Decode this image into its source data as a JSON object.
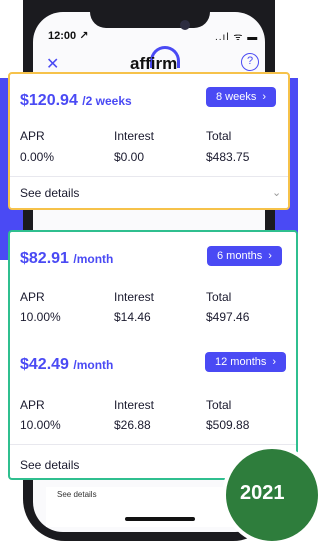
{
  "status_bar": {
    "time": "12:00 ↗",
    "icons": "..ıl ᯤ ▬"
  },
  "app": {
    "close_icon": "close-icon",
    "logo": "affirm",
    "help_icon": "help-icon",
    "help_glyph": "?"
  },
  "plans": [
    {
      "amount": "$120.94",
      "period": "/2 weeks",
      "term": "8 weeks",
      "apr": "0.00%",
      "interest": "$0.00",
      "total": "$483.75"
    },
    {
      "amount": "$82.91",
      "period": "/month",
      "term": "6 months",
      "apr": "10.00%",
      "interest": "$14.46",
      "total": "$497.46"
    },
    {
      "amount": "$42.49",
      "period": "/month",
      "term": "12 months",
      "apr": "10.00%",
      "interest": "$26.88",
      "total": "$509.88"
    }
  ],
  "labels": {
    "apr": "APR",
    "interest": "Interest",
    "total": "Total",
    "see_details": "See details"
  },
  "badge": {
    "year": "2021"
  },
  "colors": {
    "accent": "#4a4af4",
    "card1_border": "#f6c24a",
    "card2_border": "#2fbf8f",
    "badge": "#2e7d3c"
  }
}
